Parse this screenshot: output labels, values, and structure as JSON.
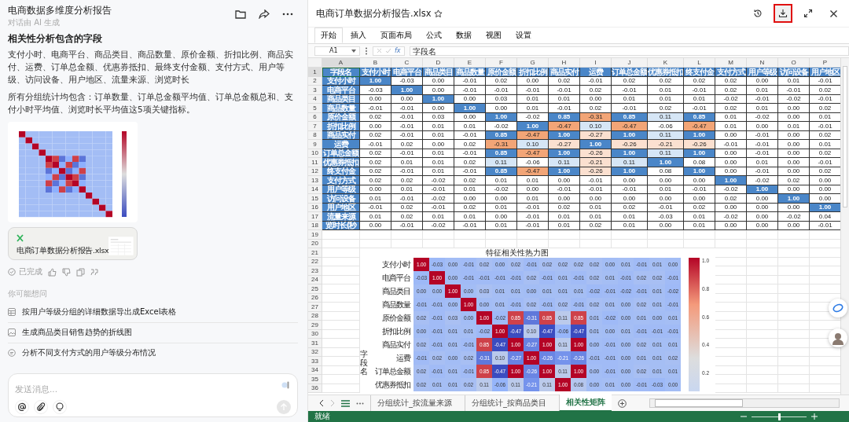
{
  "chat": {
    "title": "电商数据多维度分析报告",
    "subtitle": "对话由 AI 生成",
    "heading": "相关性分析包含的字段",
    "paragraphs": [
      "支付小时、电商平台、商品类目、商品数量、原价金额、折扣比例、商品实付、运费、订单总金额、优惠券抵扣、最终支付金额、支付方式、用户等级、访问设备、用户地区、流量来源、浏览时长",
      "所有分组统计均包含：订单数量、订单总金额平均值、订单总金额总和、支付小时平均值、浏览时长平均值这5项关键指标。"
    ],
    "attachment": {
      "name": "电商订单数据分析报告.xlsx"
    },
    "status": "已完成",
    "suggestions_title": "你可能想问",
    "suggestions": [
      {
        "kind": "table",
        "text": "按用户等级分组的详细数据导出成Excel表格"
      },
      {
        "kind": "image",
        "text": "生成商品类目销售趋势的折线图"
      },
      {
        "kind": "chat",
        "text": "分析不同支付方式的用户等级分布情况"
      }
    ],
    "input": {
      "placeholder": "发送消息..."
    }
  },
  "sheet": {
    "title": "电商订单数据分析报告.xlsx",
    "download_button": {
      "highlighted": true
    },
    "ribbon_tabs": [
      {
        "label": "开始",
        "selected": true
      },
      {
        "label": "插入",
        "selected": false
      },
      {
        "label": "页面布局",
        "selected": false
      },
      {
        "label": "公式",
        "selected": false
      },
      {
        "label": "数据",
        "selected": false
      },
      {
        "label": "视图",
        "selected": false
      },
      {
        "label": "设置",
        "selected": false
      }
    ],
    "name_box": "A1",
    "function_label": "fx",
    "formula": "字段名",
    "column_letters": [
      "A",
      "B",
      "C",
      "D",
      "E",
      "F",
      "G",
      "H",
      "I",
      "J",
      "K",
      "L",
      "M",
      "N",
      "O",
      "P"
    ],
    "row_numbers": [
      "1",
      "2",
      "3",
      "4",
      "5",
      "6",
      "7",
      "8",
      "9",
      "10",
      "11",
      "12",
      "13",
      "14",
      "15",
      "16",
      "17",
      "18",
      "19",
      "20",
      "21",
      "22",
      "23",
      "24",
      "25",
      "26",
      "27",
      "28",
      "29",
      "30",
      "31",
      "32",
      "33",
      "34",
      "35",
      "36"
    ],
    "header": [
      "字段名",
      "支付小时",
      "电商平台",
      "商品类目",
      "商品数量",
      "原价金额",
      "折扣比例",
      "商品实付",
      "运费",
      "订单总金额",
      "优惠券抵扣",
      "终支付金",
      "支付方式",
      "用户等级",
      "访问设备",
      "用户地区"
    ],
    "rows": [
      [
        "支付小时",
        "1.00",
        "-0.03",
        "0.00",
        "-0.01",
        "0.02",
        "0.00",
        "0.02",
        "-0.01",
        "0.02",
        "0.02",
        "0.02",
        "0.02",
        "0.00",
        "0.01",
        "-0.01"
      ],
      [
        "电商平台",
        "-0.03",
        "1.00",
        "0.00",
        "-0.01",
        "-0.01",
        "-0.01",
        "-0.01",
        "0.02",
        "-0.01",
        "0.01",
        "-0.01",
        "0.02",
        "0.01",
        "-0.01",
        "0.02"
      ],
      [
        "商品类目",
        "0.00",
        "0.00",
        "1.00",
        "0.00",
        "0.03",
        "0.01",
        "0.01",
        "0.00",
        "0.01",
        "0.01",
        "0.01",
        "-0.02",
        "-0.01",
        "-0.02",
        "-0.01"
      ],
      [
        "商品数量",
        "-0.01",
        "-0.01",
        "0.00",
        "1.00",
        "0.00",
        "0.01",
        "-0.01",
        "0.02",
        "-0.01",
        "0.02",
        "-0.01",
        "0.02",
        "0.01",
        "0.00",
        "0.02"
      ],
      [
        "原价金额",
        "0.02",
        "-0.01",
        "0.03",
        "0.00",
        "1.00",
        "-0.02",
        "0.85",
        "-0.31",
        "0.85",
        "0.11",
        "0.85",
        "0.01",
        "-0.02",
        "0.00",
        "0.01"
      ],
      [
        "折扣比例",
        "0.00",
        "-0.01",
        "0.01",
        "0.01",
        "-0.02",
        "1.00",
        "-0.47",
        "0.10",
        "-0.47",
        "-0.06",
        "-0.47",
        "0.01",
        "0.00",
        "0.01",
        "-0.01"
      ],
      [
        "商品实付",
        "0.02",
        "-0.01",
        "0.01",
        "-0.01",
        "0.85",
        "-0.47",
        "1.00",
        "-0.27",
        "1.00",
        "0.11",
        "1.00",
        "0.00",
        "-0.01",
        "0.00",
        "0.02"
      ],
      [
        "运费",
        "-0.01",
        "0.02",
        "0.00",
        "0.02",
        "-0.31",
        "0.10",
        "-0.27",
        "1.00",
        "-0.26",
        "-0.21",
        "-0.26",
        "-0.01",
        "-0.01",
        "0.00",
        "0.01"
      ],
      [
        "订单总金额",
        "0.02",
        "-0.01",
        "0.01",
        "-0.01",
        "0.85",
        "-0.47",
        "1.00",
        "-0.26",
        "1.00",
        "0.11",
        "1.00",
        "0.00",
        "-0.01",
        "0.00",
        "0.02"
      ],
      [
        "优惠券抵扣",
        "0.02",
        "0.01",
        "0.01",
        "0.02",
        "0.11",
        "-0.06",
        "0.11",
        "-0.21",
        "0.11",
        "1.00",
        "0.08",
        "0.00",
        "0.01",
        "0.00",
        "-0.01"
      ],
      [
        "终支付金",
        "0.02",
        "-0.01",
        "0.01",
        "-0.01",
        "0.85",
        "-0.47",
        "1.00",
        "-0.26",
        "1.00",
        "0.08",
        "1.00",
        "0.00",
        "-0.01",
        "0.00",
        "0.02"
      ],
      [
        "支付方式",
        "0.02",
        "0.02",
        "-0.02",
        "0.02",
        "0.01",
        "0.01",
        "0.00",
        "-0.01",
        "0.00",
        "0.00",
        "0.00",
        "1.00",
        "-0.02",
        "0.02",
        "0.00"
      ],
      [
        "用户等级",
        "0.00",
        "0.01",
        "-0.01",
        "0.01",
        "-0.02",
        "0.00",
        "-0.01",
        "-0.01",
        "-0.01",
        "0.01",
        "-0.01",
        "-0.02",
        "1.00",
        "0.00",
        "0.00"
      ],
      [
        "访问设备",
        "0.01",
        "-0.01",
        "-0.02",
        "0.00",
        "0.00",
        "0.01",
        "0.00",
        "0.00",
        "0.00",
        "0.00",
        "0.00",
        "0.02",
        "0.00",
        "1.00",
        "0.00"
      ],
      [
        "用户地区",
        "-0.01",
        "0.02",
        "-0.01",
        "0.02",
        "0.01",
        "-0.01",
        "0.02",
        "0.01",
        "0.02",
        "-0.01",
        "0.02",
        "0.00",
        "0.00",
        "0.00",
        "1.00"
      ],
      [
        "流量来源",
        "0.01",
        "0.02",
        "0.01",
        "0.01",
        "0.00",
        "-0.01",
        "0.01",
        "0.01",
        "0.01",
        "-0.03",
        "0.01",
        "-0.02",
        "0.00",
        "-0.02",
        "0.04"
      ],
      [
        "览时长(秒",
        "0.00",
        "-0.01",
        "-0.02",
        "-0.01",
        "0.01",
        "-0.01",
        "0.01",
        "0.02",
        "0.01",
        "0.00",
        "0.01",
        "0.00",
        "0.00",
        "0.00",
        "-0.01"
      ]
    ],
    "heatmap": {
      "title": "特征相关性热力图",
      "ylabel": "字段名",
      "colorbar_ticks": [
        "1.0",
        "0.8",
        "0.6",
        "0.4",
        "0.2"
      ],
      "rows": [
        {
          "label": "支付小时",
          "values": [
            "1.00",
            "-0.03",
            "0.00",
            "-0.01",
            "0.02",
            "0.00",
            "0.02",
            "-0.01",
            "0.02",
            "0.02",
            "0.02",
            "0.02",
            "0.00",
            "0.01",
            "-0.01",
            "0.01",
            "0.00"
          ]
        },
        {
          "label": "电商平台",
          "values": [
            "-0.03",
            "1.00",
            "0.00",
            "-0.01",
            "-0.01",
            "-0.01",
            "-0.01",
            "0.02",
            "-0.01",
            "0.01",
            "-0.01",
            "0.02",
            "0.01",
            "-0.01",
            "0.02",
            "0.02",
            "-0.01"
          ]
        },
        {
          "label": "商品类目",
          "values": [
            "0.00",
            "0.00",
            "1.00",
            "0.00",
            "0.03",
            "0.01",
            "0.01",
            "0.00",
            "0.01",
            "0.01",
            "0.01",
            "-0.02",
            "-0.01",
            "-0.02",
            "-0.01",
            "0.01",
            "-0.02"
          ]
        },
        {
          "label": "商品数量",
          "values": [
            "-0.01",
            "-0.01",
            "0.00",
            "1.00",
            "0.00",
            "0.01",
            "-0.01",
            "0.02",
            "-0.01",
            "0.02",
            "-0.01",
            "0.02",
            "0.01",
            "0.00",
            "0.02",
            "0.01",
            "-0.01"
          ]
        },
        {
          "label": "原价金额",
          "values": [
            "0.02",
            "-0.01",
            "0.03",
            "0.00",
            "1.00",
            "-0.02",
            "0.85",
            "-0.31",
            "0.85",
            "0.11",
            "0.85",
            "0.01",
            "-0.02",
            "0.00",
            "0.01",
            "0.00",
            "0.01"
          ]
        },
        {
          "label": "折扣比例",
          "values": [
            "0.00",
            "-0.01",
            "0.01",
            "0.01",
            "-0.02",
            "1.00",
            "-0.47",
            "0.10",
            "-0.47",
            "-0.06",
            "-0.47",
            "0.01",
            "0.00",
            "0.01",
            "-0.01",
            "-0.01",
            "-0.01"
          ]
        },
        {
          "label": "商品实付",
          "values": [
            "0.02",
            "-0.01",
            "0.01",
            "-0.01",
            "0.85",
            "-0.47",
            "1.00",
            "-0.27",
            "1.00",
            "0.11",
            "1.00",
            "0.00",
            "-0.01",
            "0.00",
            "0.02",
            "0.01",
            "0.01"
          ]
        },
        {
          "label": "运费",
          "values": [
            "-0.01",
            "0.02",
            "0.00",
            "0.02",
            "-0.31",
            "0.10",
            "-0.27",
            "1.00",
            "-0.26",
            "-0.21",
            "-0.26",
            "-0.01",
            "-0.01",
            "0.00",
            "0.01",
            "0.01",
            "0.02"
          ]
        },
        {
          "label": "订单总金额",
          "values": [
            "0.02",
            "-0.01",
            "0.01",
            "-0.01",
            "0.85",
            "-0.47",
            "1.00",
            "-0.26",
            "1.00",
            "0.11",
            "1.00",
            "0.00",
            "-0.01",
            "0.00",
            "0.02",
            "0.01",
            "0.01"
          ]
        },
        {
          "label": "优惠券抵扣",
          "values": [
            "0.02",
            "0.01",
            "0.01",
            "0.02",
            "0.11",
            "-0.06",
            "0.11",
            "-0.21",
            "0.11",
            "1.00",
            "0.08",
            "0.00",
            "0.01",
            "0.00",
            "-0.01",
            "-0.03",
            "0.00"
          ]
        }
      ]
    },
    "sheet_tabs": [
      {
        "label": "分组统计_按流量来源",
        "selected": false
      },
      {
        "label": "分组统计_按商品类目",
        "selected": false
      },
      {
        "label": "相关性矩阵",
        "selected": true
      }
    ],
    "status": "就绪",
    "zoom": {
      "level": 0.5
    }
  }
}
